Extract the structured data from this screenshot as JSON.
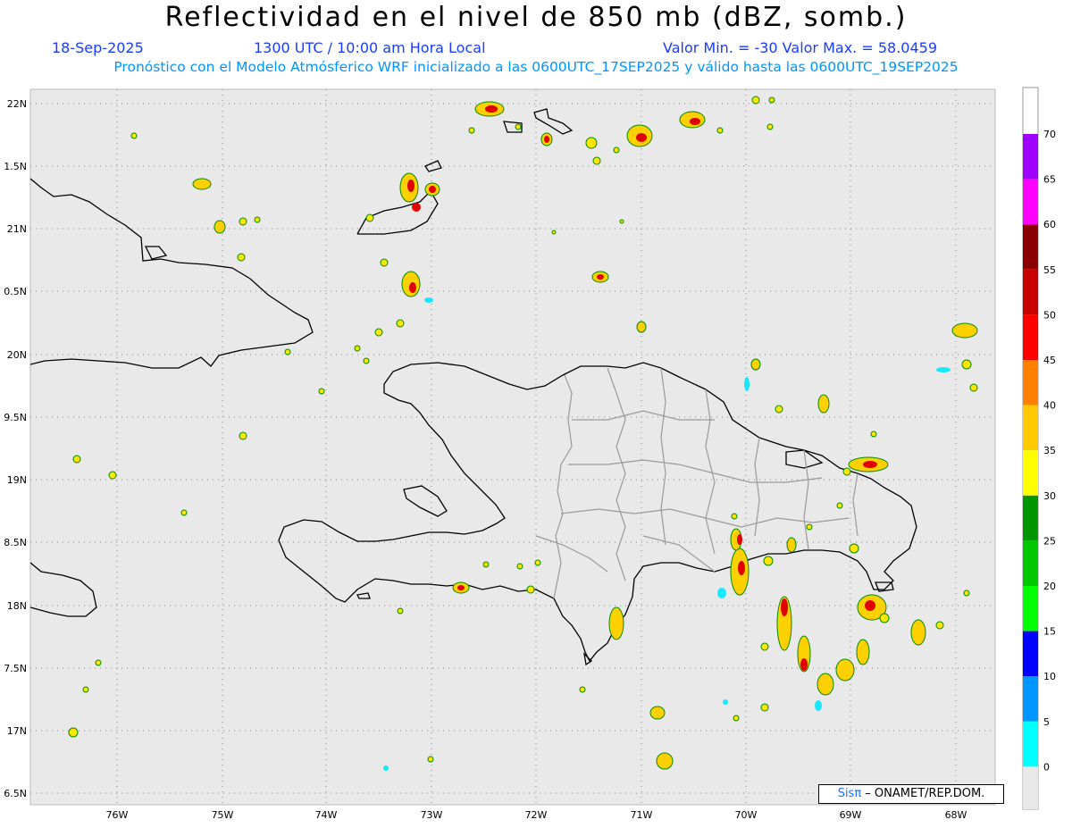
{
  "header": {
    "title": "Reflectividad en el nivel de 850 mb (dBZ, somb.)",
    "date": "18-Sep-2025",
    "time": "1300 UTC / 10:00 am Hora Local",
    "minmax": "Valor Min. = -30  Valor Max. = 58.0459",
    "forecast": "Pronóstico con el Modelo Atmósferico WRF inicializado a las 0600UTC_17SEP2025 y válido hasta las  0600UTC_19SEP2025"
  },
  "axes": {
    "x_ticks": [
      "76W",
      "75W",
      "74W",
      "73W",
      "72W",
      "71W",
      "70W",
      "69W",
      "68W"
    ],
    "y_ticks": [
      "22N",
      "1.5N",
      "21N",
      "0.5N",
      "20N",
      "9.5N",
      "19N",
      "8.5N",
      "18N",
      "7.5N",
      "17N",
      "6.5N"
    ]
  },
  "colorbar": {
    "labels": [
      "70",
      "65",
      "60",
      "55",
      "50",
      "45",
      "40",
      "35",
      "30",
      "25",
      "20",
      "15",
      "10",
      "5",
      "0"
    ],
    "colors": [
      "#a000ff",
      "#ff00ff",
      "#8b0000",
      "#c80000",
      "#ff0000",
      "#ff7f00",
      "#ffc800",
      "#ffff00",
      "#009600",
      "#00c800",
      "#00ff00",
      "#0000ff",
      "#0096ff",
      "#00ffff",
      "#e8e8e8"
    ]
  },
  "credit": {
    "brand": "Sisπ",
    "text": " – ONAMET/REP.DOM."
  }
}
